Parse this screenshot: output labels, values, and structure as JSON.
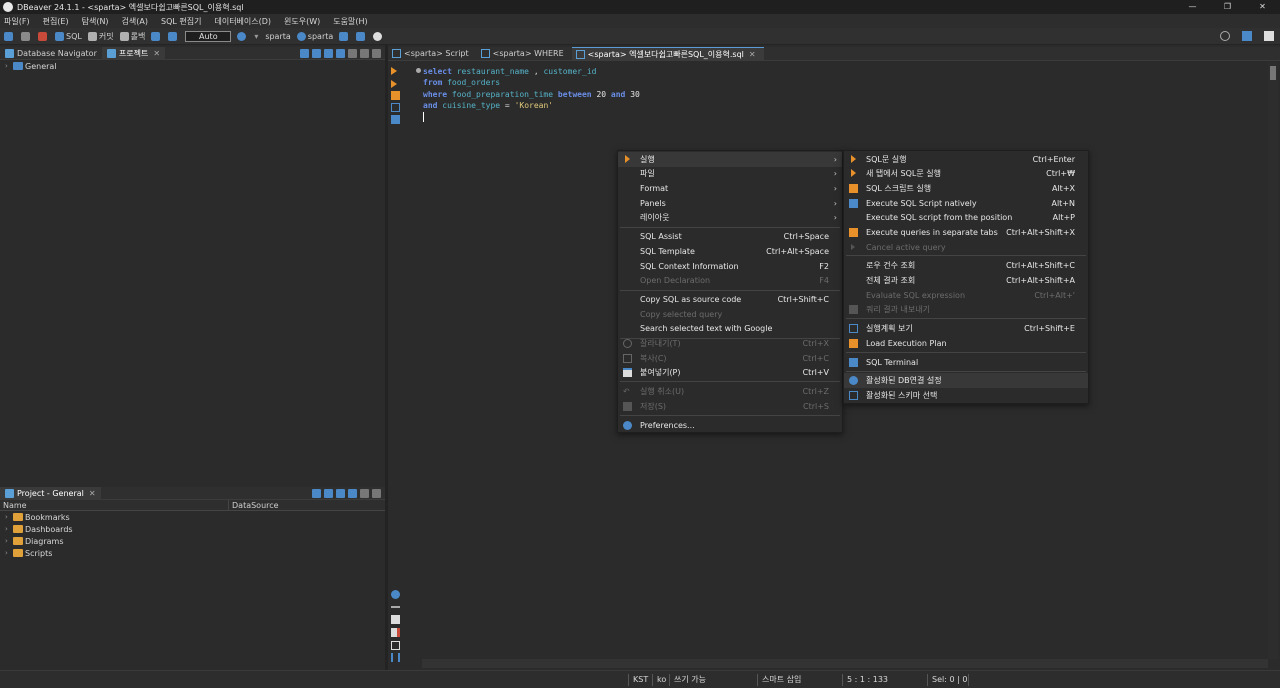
{
  "window": {
    "title": "DBeaver 24.1.1 - <sparta> 엑셀보다쉽고빠른SQL_이용혁.sql"
  },
  "menubar": [
    "파일(F)",
    "편집(E)",
    "탐색(N)",
    "검색(A)",
    "SQL 편집기",
    "데이터베이스(D)",
    "윈도우(W)",
    "도움말(H)"
  ],
  "toolbar": {
    "sql": "SQL",
    "commit": "커밋",
    "rollback": "롤백",
    "mode": "Auto",
    "datasource": "sparta",
    "schema": "sparta"
  },
  "left_top": {
    "tabs": [
      "Database Navigator",
      "프로젝트"
    ],
    "tree": [
      "General"
    ]
  },
  "left_bottom": {
    "tab": "Project - General",
    "columns": [
      "Name",
      "DataSource"
    ],
    "items": [
      "Bookmarks",
      "Dashboards",
      "Diagrams",
      "Scripts"
    ]
  },
  "editor_tabs": [
    "<sparta> Script",
    "<sparta> WHERE",
    "<sparta> 엑셀보다쉽고빠른SQL_이용혁.sql"
  ],
  "code": {
    "l1": [
      "select",
      "restaurant_name",
      ",",
      "customer_id"
    ],
    "l2": [
      "from",
      "food_orders"
    ],
    "l3": [
      "where",
      "food_preparation_time",
      "between",
      "20",
      "and",
      "30"
    ],
    "l4": [
      "and",
      "cuisine_type",
      "=",
      "'Korean'"
    ]
  },
  "context_menu": {
    "items": [
      {
        "label": "실행"
      },
      {
        "label": "파일"
      },
      {
        "label": "Format"
      },
      {
        "label": "Panels"
      },
      {
        "label": "레이아웃"
      },
      {
        "label": "SQL Assist",
        "shortcut": "Ctrl+Space"
      },
      {
        "label": "SQL Template",
        "shortcut": "Ctrl+Alt+Space"
      },
      {
        "label": "SQL Context Information",
        "shortcut": "F2"
      },
      {
        "label": "Open Declaration",
        "shortcut": "F4"
      },
      {
        "label": "Copy SQL as source code",
        "shortcut": "Ctrl+Shift+C"
      },
      {
        "label": "Copy selected query"
      },
      {
        "label": "Search selected text with Google"
      },
      {
        "label": "잘라내기(T)",
        "shortcut": "Ctrl+X"
      },
      {
        "label": "복사(C)",
        "shortcut": "Ctrl+C"
      },
      {
        "label": "붙여넣기(P)",
        "shortcut": "Ctrl+V"
      },
      {
        "label": "실행 취소(U)",
        "shortcut": "Ctrl+Z"
      },
      {
        "label": "저장(S)",
        "shortcut": "Ctrl+S"
      },
      {
        "label": "Preferences..."
      }
    ]
  },
  "submenu": {
    "items": [
      {
        "label": "SQL문 실행",
        "shortcut": "Ctrl+Enter"
      },
      {
        "label": "새 탭에서 SQL문 실행",
        "shortcut": "Ctrl+₩"
      },
      {
        "label": "SQL 스크립트 실행",
        "shortcut": "Alt+X"
      },
      {
        "label": "Execute SQL Script natively",
        "shortcut": "Alt+N"
      },
      {
        "label": "Execute SQL script from the position",
        "shortcut": "Alt+P"
      },
      {
        "label": "Execute queries in separate tabs",
        "shortcut": "Ctrl+Alt+Shift+X"
      },
      {
        "label": "Cancel active query"
      },
      {
        "label": "로우 건수 조회",
        "shortcut": "Ctrl+Alt+Shift+C"
      },
      {
        "label": "전체 결과 조회",
        "shortcut": "Ctrl+Alt+Shift+A"
      },
      {
        "label": "Evaluate SQL expression",
        "shortcut": "Ctrl+Alt+'"
      },
      {
        "label": "쿼리 결과 내보내기"
      },
      {
        "label": "실행계획 보기",
        "shortcut": "Ctrl+Shift+E"
      },
      {
        "label": "Load Execution Plan"
      },
      {
        "label": "SQL Terminal"
      },
      {
        "label": "활성화된 DB연결 설정"
      },
      {
        "label": "활성화된 스키마 선택"
      }
    ]
  },
  "statusbar": {
    "tz": "KST",
    "lang": "ko",
    "write": "쓰기 가능",
    "insert": "스마트 삽입",
    "pos": "5 : 1 : 133",
    "sel": "Sel: 0 | 0"
  }
}
